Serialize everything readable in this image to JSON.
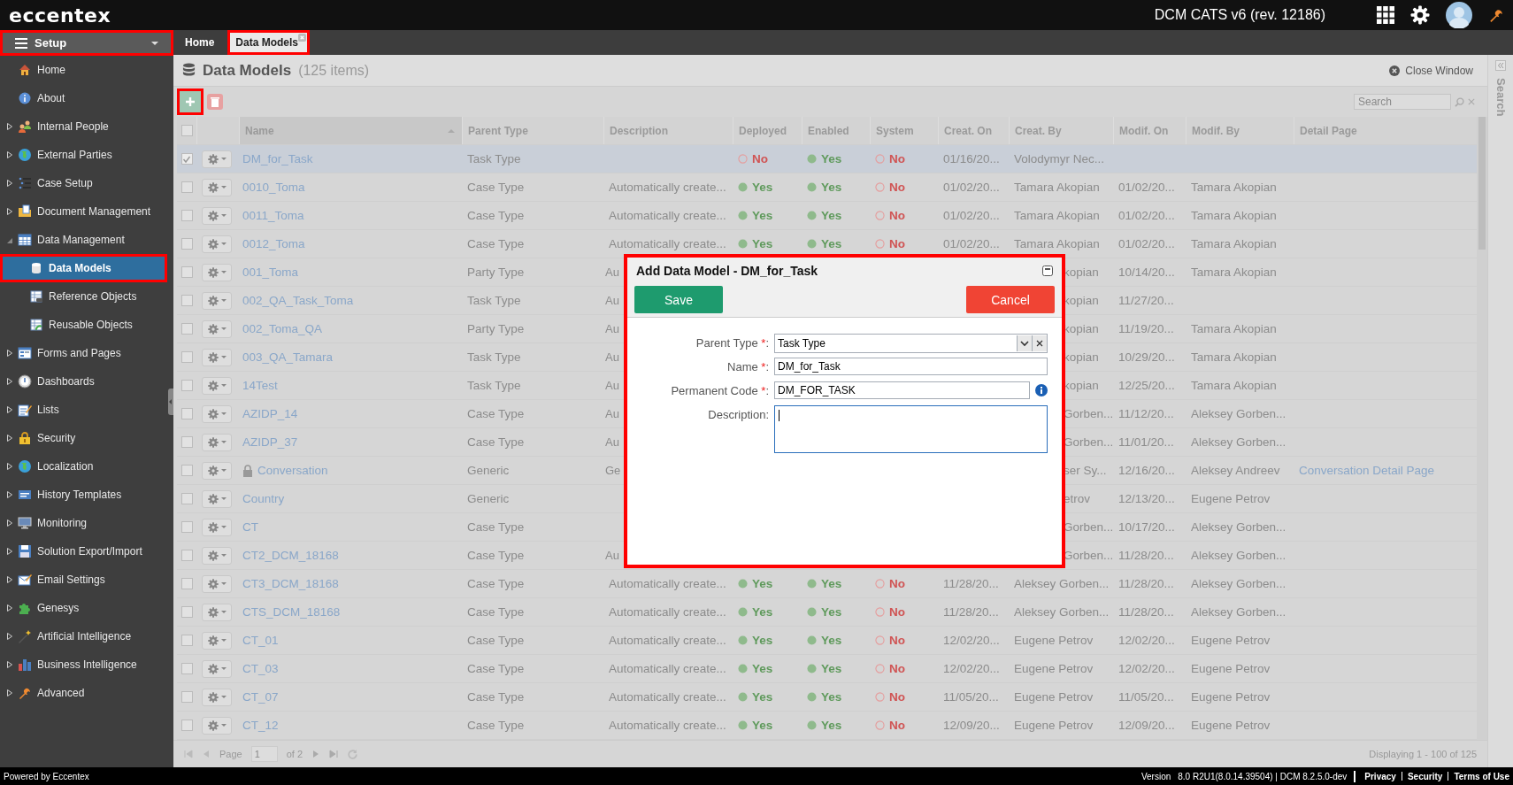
{
  "topbar": {
    "logo": "eccentex",
    "app_title": "DCM CATS v6 (rev. 12186)"
  },
  "sidebar": {
    "header": {
      "label": "Setup",
      "highlighted": true
    },
    "items": [
      {
        "label": "Home",
        "selected": false,
        "highlighted": false
      },
      {
        "label": "About",
        "selected": false,
        "highlighted": false
      },
      {
        "label": "Internal People",
        "expanded": false,
        "selected": false,
        "highlighted": false
      },
      {
        "label": "External Parties",
        "expanded": false,
        "selected": false,
        "highlighted": false
      },
      {
        "label": "Case Setup",
        "expanded": false,
        "selected": false,
        "highlighted": false
      },
      {
        "label": "Document Management",
        "expanded": false,
        "selected": false,
        "highlighted": false
      },
      {
        "label": "Data Management",
        "expanded": true,
        "selected": false,
        "highlighted": false,
        "children": [
          {
            "label": "Data Models",
            "selected": true,
            "highlighted": true
          },
          {
            "label": "Reference Objects",
            "selected": false,
            "highlighted": false
          },
          {
            "label": "Reusable Objects",
            "selected": false,
            "highlighted": false
          }
        ]
      },
      {
        "label": "Forms and Pages",
        "expanded": false,
        "selected": false,
        "highlighted": false
      },
      {
        "label": "Dashboards",
        "expanded": false,
        "selected": false,
        "highlighted": false
      },
      {
        "label": "Lists",
        "expanded": false,
        "selected": false,
        "highlighted": false
      },
      {
        "label": "Security",
        "expanded": false,
        "selected": false,
        "highlighted": false
      },
      {
        "label": "Localization",
        "expanded": false,
        "selected": false,
        "highlighted": false
      },
      {
        "label": "History Templates",
        "expanded": false,
        "selected": false,
        "highlighted": false
      },
      {
        "label": "Monitoring",
        "expanded": false,
        "selected": false,
        "highlighted": false
      },
      {
        "label": "Solution Export/Import",
        "expanded": false,
        "selected": false,
        "highlighted": false
      },
      {
        "label": "Email Settings",
        "expanded": false,
        "selected": false,
        "highlighted": false
      },
      {
        "label": "Genesys",
        "expanded": false,
        "selected": false,
        "highlighted": false
      },
      {
        "label": "Artificial Intelligence",
        "expanded": false,
        "selected": false,
        "highlighted": false
      },
      {
        "label": "Business Intelligence",
        "expanded": false,
        "selected": false,
        "highlighted": false
      },
      {
        "label": "Advanced",
        "expanded": false,
        "selected": false,
        "highlighted": false
      }
    ]
  },
  "tabs": [
    {
      "label": "Home",
      "selected": false,
      "highlighted": false,
      "closable": false
    },
    {
      "label": "Data Models",
      "selected": true,
      "highlighted": true,
      "closable": true
    }
  ],
  "page": {
    "title": "Data Models",
    "count": "(125 items)",
    "close_label": "Close Window"
  },
  "toolbar": {
    "add_highlighted": true,
    "search_placeholder": "Search"
  },
  "side_panel": {
    "label": "Search"
  },
  "table": {
    "all_checked": false,
    "columns": [
      {
        "label": "Name",
        "sorted": true
      },
      {
        "label": "Parent Type",
        "sorted": false
      },
      {
        "label": "Description",
        "sorted": false
      },
      {
        "label": "Deployed",
        "sorted": false
      },
      {
        "label": "Enabled",
        "sorted": false
      },
      {
        "label": "System",
        "sorted": false
      },
      {
        "label": "Creat. On",
        "sorted": false
      },
      {
        "label": "Creat. By",
        "sorted": false
      },
      {
        "label": "Modif. On",
        "sorted": false
      },
      {
        "label": "Modif. By",
        "sorted": false
      },
      {
        "label": "Detail Page",
        "sorted": false
      }
    ],
    "rows": [
      {
        "checked": true,
        "selected": true,
        "covered": false,
        "locked": false,
        "name": "DM_for_Task",
        "parent_type": "Task Type",
        "deployed": {
          "text": "No",
          "on": false
        },
        "enabled": {
          "text": "Yes",
          "on": true
        },
        "system": {
          "text": "No",
          "on": false
        },
        "created_on": "01/16/20...",
        "created_by": "Volodymyr Nec..."
      },
      {
        "checked": false,
        "selected": false,
        "covered": false,
        "locked": false,
        "name": "0010_Toma",
        "parent_type": "Case Type",
        "description": "Automatically create...",
        "deployed": {
          "text": "Yes",
          "on": true
        },
        "enabled": {
          "text": "Yes",
          "on": true
        },
        "system": {
          "text": "No",
          "on": false
        },
        "created_on": "01/02/20...",
        "created_by": "Tamara Akopian",
        "modified_on": "01/02/20...",
        "modified_by": "Tamara Akopian"
      },
      {
        "checked": false,
        "selected": false,
        "covered": false,
        "locked": false,
        "name": "0011_Toma",
        "parent_type": "Case Type",
        "description": "Automatically create...",
        "deployed": {
          "text": "Yes",
          "on": true
        },
        "enabled": {
          "text": "Yes",
          "on": true
        },
        "system": {
          "text": "No",
          "on": false
        },
        "created_on": "01/02/20...",
        "created_by": "Tamara Akopian",
        "modified_on": "01/02/20...",
        "modified_by": "Tamara Akopian"
      },
      {
        "checked": false,
        "selected": false,
        "covered": false,
        "locked": false,
        "name": "0012_Toma",
        "parent_type": "Case Type",
        "description": "Automatically create...",
        "deployed": {
          "text": "Yes",
          "on": true
        },
        "enabled": {
          "text": "Yes",
          "on": true
        },
        "system": {
          "text": "No",
          "on": false
        },
        "created_on": "01/02/20...",
        "created_by": "Tamara Akopian",
        "modified_on": "01/02/20...",
        "modified_by": "Tamara Akopian"
      },
      {
        "checked": false,
        "selected": false,
        "covered": true,
        "locked": false,
        "name": "001_Toma",
        "parent_type": "Party Type",
        "description": "Au",
        "created_by": "kopian",
        "modified_on": "10/14/20...",
        "modified_by": "Tamara Akopian"
      },
      {
        "checked": false,
        "selected": false,
        "covered": true,
        "locked": false,
        "name": "002_QA_Task_Toma",
        "parent_type": "Task Type",
        "description": "Au",
        "created_by": "kopian",
        "modified_on": "11/27/20..."
      },
      {
        "checked": false,
        "selected": false,
        "covered": true,
        "locked": false,
        "name": "002_Toma_QA",
        "parent_type": "Party Type",
        "description": "Au",
        "created_by": "kopian",
        "modified_on": "11/19/20...",
        "modified_by": "Tamara Akopian"
      },
      {
        "checked": false,
        "selected": false,
        "covered": true,
        "locked": false,
        "name": "003_QA_Tamara",
        "parent_type": "Task Type",
        "description": "Au",
        "created_by": "kopian",
        "modified_on": "10/29/20...",
        "modified_by": "Tamara Akopian"
      },
      {
        "checked": false,
        "selected": false,
        "covered": true,
        "locked": false,
        "name": "14Test",
        "parent_type": "Task Type",
        "description": "Au",
        "created_by": "kopian",
        "modified_on": "12/25/20...",
        "modified_by": "Tamara Akopian"
      },
      {
        "checked": false,
        "selected": false,
        "covered": true,
        "locked": false,
        "name": "AZIDP_14",
        "parent_type": "Case Type",
        "description": "Au",
        "created_by": "Gorben...",
        "modified_on": "11/12/20...",
        "modified_by": "Aleksey Gorben..."
      },
      {
        "checked": false,
        "selected": false,
        "covered": true,
        "locked": false,
        "name": "AZIDP_37",
        "parent_type": "Case Type",
        "description": "Au",
        "created_by": "Gorben...",
        "modified_on": "11/01/20...",
        "modified_by": "Aleksey Gorben..."
      },
      {
        "checked": false,
        "selected": false,
        "covered": true,
        "locked": true,
        "name": "Conversation",
        "parent_type": "Generic",
        "description": "Ge",
        "created_by": "ser Sy...",
        "modified_on": "12/16/20...",
        "modified_by": "Aleksey Andreev",
        "detail_page": "Conversation Detail Page"
      },
      {
        "checked": false,
        "selected": false,
        "covered": true,
        "locked": false,
        "name": "Country",
        "parent_type": "Generic",
        "created_by": "etrov",
        "modified_on": "12/13/20...",
        "modified_by": "Eugene Petrov"
      },
      {
        "checked": false,
        "selected": false,
        "covered": true,
        "locked": false,
        "name": "CT",
        "parent_type": "Case Type",
        "created_by": "Gorben...",
        "modified_on": "10/17/20...",
        "modified_by": "Aleksey Gorben..."
      },
      {
        "checked": false,
        "selected": false,
        "covered": true,
        "locked": false,
        "name": "CT2_DCM_18168",
        "parent_type": "Case Type",
        "description": "Au",
        "created_by": "Gorben...",
        "modified_on": "11/28/20...",
        "modified_by": "Aleksey Gorben..."
      },
      {
        "checked": false,
        "selected": false,
        "covered": false,
        "locked": false,
        "name": "CT3_DCM_18168",
        "parent_type": "Case Type",
        "description": "Automatically create...",
        "deployed": {
          "text": "Yes",
          "on": true
        },
        "enabled": {
          "text": "Yes",
          "on": true
        },
        "system": {
          "text": "No",
          "on": false
        },
        "created_on": "11/28/20...",
        "created_by": "Aleksey Gorben...",
        "modified_on": "11/28/20...",
        "modified_by": "Aleksey Gorben..."
      },
      {
        "checked": false,
        "selected": false,
        "covered": false,
        "locked": false,
        "name": "CTS_DCM_18168",
        "parent_type": "Case Type",
        "description": "Automatically create...",
        "deployed": {
          "text": "Yes",
          "on": true
        },
        "enabled": {
          "text": "Yes",
          "on": true
        },
        "system": {
          "text": "No",
          "on": false
        },
        "created_on": "11/28/20...",
        "created_by": "Aleksey Gorben...",
        "modified_on": "11/28/20...",
        "modified_by": "Aleksey Gorben..."
      },
      {
        "checked": false,
        "selected": false,
        "covered": false,
        "locked": false,
        "name": "CT_01",
        "parent_type": "Case Type",
        "description": "Automatically create...",
        "deployed": {
          "text": "Yes",
          "on": true
        },
        "enabled": {
          "text": "Yes",
          "on": true
        },
        "system": {
          "text": "No",
          "on": false
        },
        "created_on": "12/02/20...",
        "created_by": "Eugene Petrov",
        "modified_on": "12/02/20...",
        "modified_by": "Eugene Petrov"
      },
      {
        "checked": false,
        "selected": false,
        "covered": false,
        "locked": false,
        "name": "CT_03",
        "parent_type": "Case Type",
        "description": "Automatically create...",
        "deployed": {
          "text": "Yes",
          "on": true
        },
        "enabled": {
          "text": "Yes",
          "on": true
        },
        "system": {
          "text": "No",
          "on": false
        },
        "created_on": "12/02/20...",
        "created_by": "Eugene Petrov",
        "modified_on": "12/02/20...",
        "modified_by": "Eugene Petrov"
      },
      {
        "checked": false,
        "selected": false,
        "covered": false,
        "locked": false,
        "name": "CT_07",
        "parent_type": "Case Type",
        "description": "Automatically create...",
        "deployed": {
          "text": "Yes",
          "on": true
        },
        "enabled": {
          "text": "Yes",
          "on": true
        },
        "system": {
          "text": "No",
          "on": false
        },
        "created_on": "11/05/20...",
        "created_by": "Eugene Petrov",
        "modified_on": "11/05/20...",
        "modified_by": "Eugene Petrov"
      },
      {
        "checked": false,
        "selected": false,
        "covered": false,
        "locked": false,
        "name": "CT_12",
        "parent_type": "Case Type",
        "description": "Automatically create...",
        "deployed": {
          "text": "Yes",
          "on": true
        },
        "enabled": {
          "text": "Yes",
          "on": true
        },
        "system": {
          "text": "No",
          "on": false
        },
        "created_on": "12/09/20...",
        "created_by": "Eugene Petrov",
        "modified_on": "12/09/20...",
        "modified_by": "Eugene Petrov"
      }
    ]
  },
  "pager": {
    "page_label": "Page",
    "page": "1",
    "of": "of 2",
    "display": "Displaying 1 - 100 of 125"
  },
  "dialog": {
    "title": "Add Data Model - DM_for_Task",
    "highlighted": true,
    "buttons": [
      {
        "label": "Save",
        "kind": "primary"
      },
      {
        "label": "Cancel",
        "kind": "danger"
      }
    ],
    "fields": [
      {
        "label": "Parent Type ",
        "mark": "*",
        "end": ":",
        "kind": "select",
        "value": "Task Type"
      },
      {
        "label": "Name ",
        "mark": "*",
        "end": ":",
        "kind": "text",
        "value": "DM_for_Task"
      },
      {
        "label": "Permanent Code ",
        "mark": "*",
        "end": ":",
        "kind": "code",
        "value": "DM_FOR_TASK"
      },
      {
        "label": "Description:",
        "kind": "textarea",
        "focused": true
      }
    ]
  },
  "footer": {
    "powered": "Powered by Eccentex",
    "version_label": "Version",
    "version": "8.0 R2U1(8.0.14.39504) | DCM 8.2.5.0-dev",
    "links": [
      "Privacy",
      "Security",
      "Terms of Use"
    ]
  }
}
